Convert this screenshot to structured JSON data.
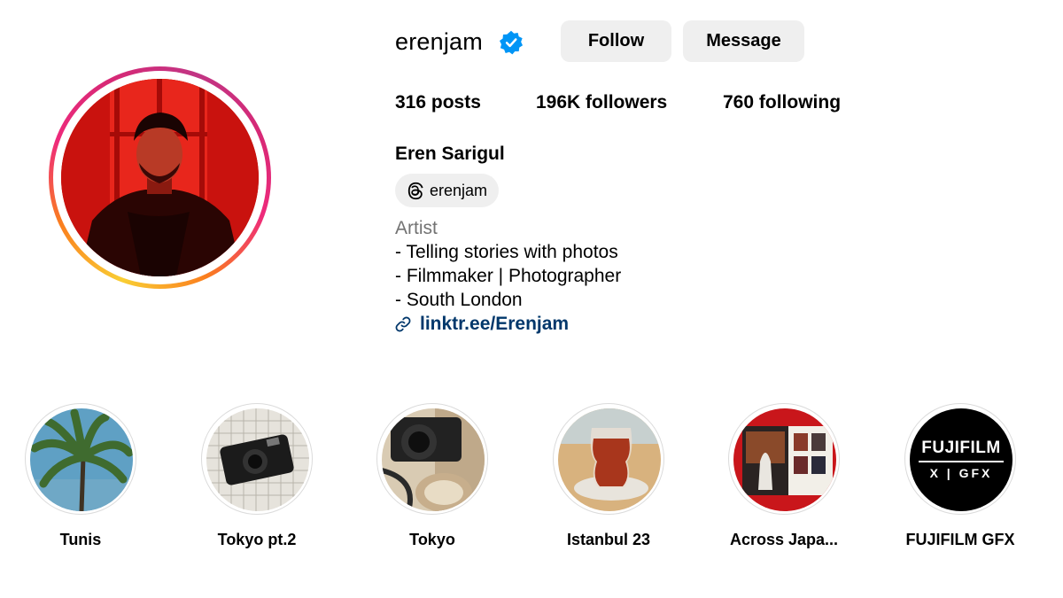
{
  "profile": {
    "username": "erenjam",
    "verified_icon": "verified-badge-icon",
    "verified_color": "#0095f6",
    "follow_label": "Follow",
    "message_label": "Message",
    "stats": {
      "posts": "316",
      "posts_label": "posts",
      "followers": "196K",
      "followers_label": "followers",
      "following": "760",
      "following_label": "following"
    },
    "full_name": "Eren Sarigul",
    "threads_handle": "erenjam",
    "category": "Artist",
    "bio_lines": [
      "- Telling stories with photos",
      "- Filmmaker | Photographer",
      "- South London"
    ],
    "link": "linktr.ee/Erenjam",
    "link_color": "#00376b"
  },
  "highlights": [
    {
      "label": "Tunis"
    },
    {
      "label": "Tokyo pt.2"
    },
    {
      "label": "Tokyo"
    },
    {
      "label": "Istanbul 23"
    },
    {
      "label": "Across Japa..."
    },
    {
      "label": "FUJIFILM GFX"
    }
  ],
  "fujifilm_logo": {
    "line1": "FUJIFILM",
    "line2": "X | GFX"
  }
}
